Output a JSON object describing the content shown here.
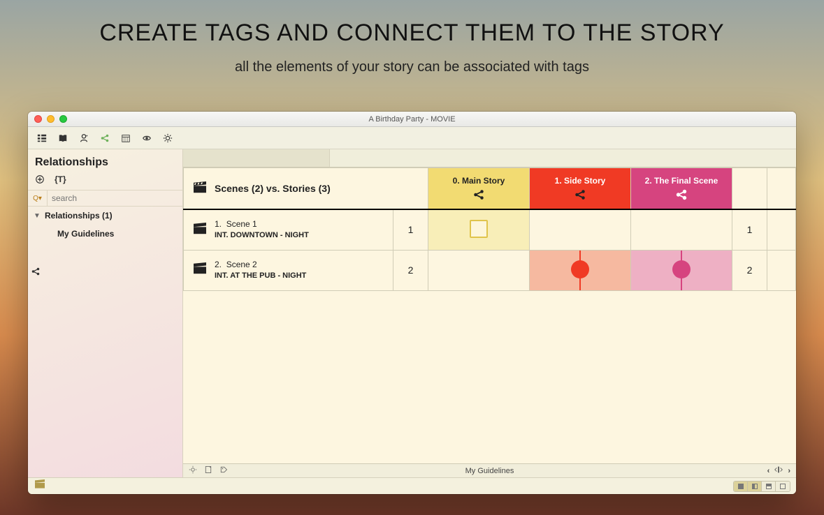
{
  "hero": {
    "title": "CREATE TAGS AND CONNECT THEM TO THE STORY",
    "subtitle": "all the elements of your story can be associated with tags"
  },
  "window": {
    "title": "A Birthday Party - MOVIE"
  },
  "sidebar": {
    "title": "Relationships",
    "search_placeholder": "search",
    "search_label": "Q▾",
    "tree": {
      "root_label": "Relationships (1)",
      "child_label": "My Guidelines"
    }
  },
  "grid": {
    "header": "Scenes (2) vs. Stories (3)",
    "stories": [
      {
        "label": "0. Main Story"
      },
      {
        "label": "1. Side Story"
      },
      {
        "label": "2. The Final Scene"
      }
    ],
    "scenes": [
      {
        "num": "1.",
        "name": "Scene 1",
        "slug": "INT.  DOWNTOWN - NIGHT",
        "count": "1",
        "marks": [
          "sq",
          "",
          ""
        ]
      },
      {
        "num": "2.",
        "name": "Scene 2",
        "slug": "INT.  AT THE PUB - NIGHT",
        "count": "2",
        "marks": [
          "",
          "red",
          "pink"
        ]
      }
    ]
  },
  "statusbar": {
    "center": "My Guidelines"
  }
}
